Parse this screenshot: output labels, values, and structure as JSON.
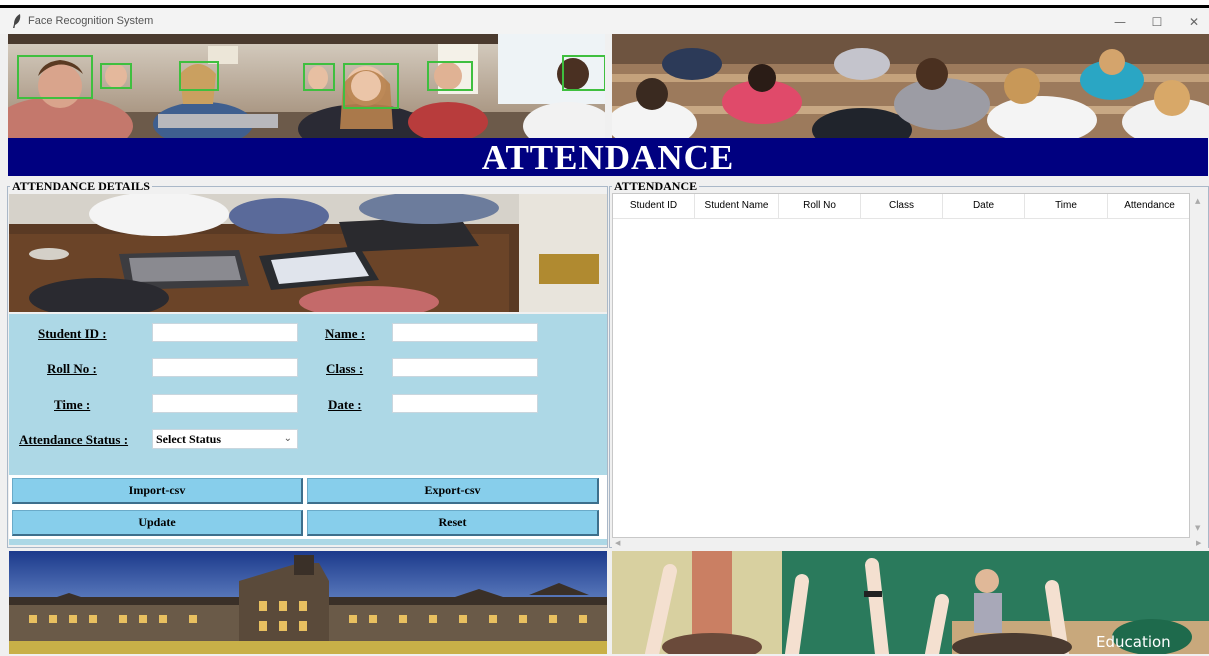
{
  "window": {
    "title": "Face Recognition System",
    "controls": {
      "minimize": "—",
      "maximize": "☐",
      "close": "✕"
    }
  },
  "banner": {
    "title": "ATTENDANCE"
  },
  "left_frame": {
    "legend": "ATTENDANCE DETAILS",
    "form": {
      "student_id_label": "Student ID :",
      "name_label": "Name :",
      "roll_label": "Roll No :",
      "class_label": "Class :",
      "time_label": "Time :",
      "date_label": "Date :",
      "status_label": "Attendance Status :",
      "student_id_value": "",
      "name_value": "",
      "roll_value": "",
      "class_value": "",
      "time_value": "",
      "date_value": "",
      "status_selected": "Select Status"
    },
    "buttons": {
      "import": "Import-csv",
      "export": "Export-csv",
      "update": "Update",
      "reset": "Reset"
    }
  },
  "right_frame": {
    "legend": "ATTENDANCE",
    "table": {
      "columns": [
        "Student ID",
        "Student Name",
        "Roll No",
        "Class",
        "Date",
        "Time",
        "Attendance"
      ],
      "rows": []
    }
  },
  "images": {
    "bottom_right_caption": "Education"
  },
  "colors": {
    "banner_bg": "#000080",
    "form_bg": "#add8e6",
    "button_bg": "#87ceeb"
  }
}
